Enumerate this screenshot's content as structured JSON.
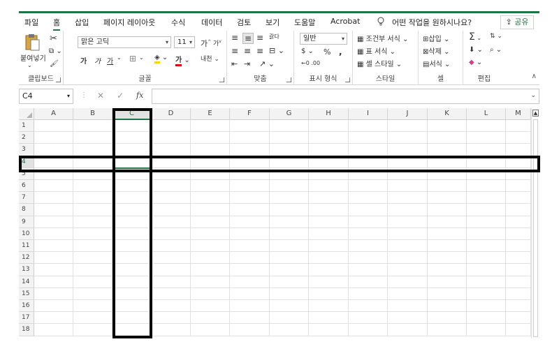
{
  "menu": {
    "tabs": [
      "파일",
      "홈",
      "삽입",
      "페이지 레이아웃",
      "수식",
      "데이터",
      "검토",
      "보기",
      "도움말",
      "Acrobat"
    ],
    "active_tab": "홈",
    "tell_me": "어떤 작업을 원하시나요?",
    "share": "공유"
  },
  "ribbon": {
    "clipboard": {
      "paste": "붙여넣기",
      "label": "클립보드"
    },
    "font": {
      "name": "맑은 고딕",
      "size": "11",
      "bold": "가",
      "italic": "가",
      "underline": "가",
      "grow": "가",
      "shrink": "가",
      "phonetic": "내천",
      "label": "글꼴"
    },
    "align": {
      "wrap": "갉다",
      "label": "맞춤"
    },
    "number": {
      "format": "일반",
      "percent": "%",
      "comma": ",",
      "label": "표시 형식"
    },
    "styles": {
      "conditional": "조건부 서식",
      "table": "표 서식",
      "cell_styles": "셀 스타일",
      "label": "스타일"
    },
    "cells": {
      "insert": "삽입",
      "delete": "삭제",
      "format": "서식",
      "label": "셀"
    },
    "editing": {
      "sum": "Σ",
      "label": "편집"
    }
  },
  "formula_bar": {
    "name_box": "C4",
    "fx": "fx",
    "value": ""
  },
  "sheet": {
    "columns": [
      "A",
      "B",
      "C",
      "D",
      "E",
      "F",
      "G",
      "H",
      "I",
      "J",
      "K",
      "L",
      "M"
    ],
    "rows": [
      "1",
      "2",
      "3",
      "4",
      "5",
      "6",
      "7",
      "8",
      "9",
      "10",
      "11",
      "12",
      "13",
      "14",
      "15",
      "16",
      "17",
      "18"
    ],
    "selected_cell": "C4",
    "highlight_row": "4",
    "highlight_column": "C"
  },
  "colors": {
    "accent": "#217346",
    "highlight": "#000000"
  }
}
